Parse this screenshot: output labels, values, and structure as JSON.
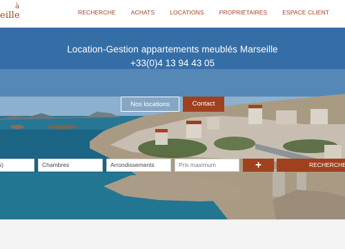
{
  "brand": {
    "line1": "à",
    "line2": "eille"
  },
  "nav": {
    "items": [
      "RECHERCHE",
      "ACHATS",
      "LOCATIONS",
      "PROPRIÉTAIRES",
      "ESPACE CLIENT"
    ]
  },
  "hero": {
    "title": "Location-Gestion appartements meublés Marseille",
    "phone": "+33(0)4 13 94 43 05",
    "btn_locations": "Nos locations",
    "btn_contact": "Contact"
  },
  "search": {
    "field1_value": "is)",
    "field2_value": "Chambres",
    "field3_value": "Arrondissements",
    "field4_placeholder": "Prix maximum",
    "plus_label": "+",
    "submit_label": "RECHERCHER"
  },
  "colors": {
    "accent": "#a0401f"
  }
}
